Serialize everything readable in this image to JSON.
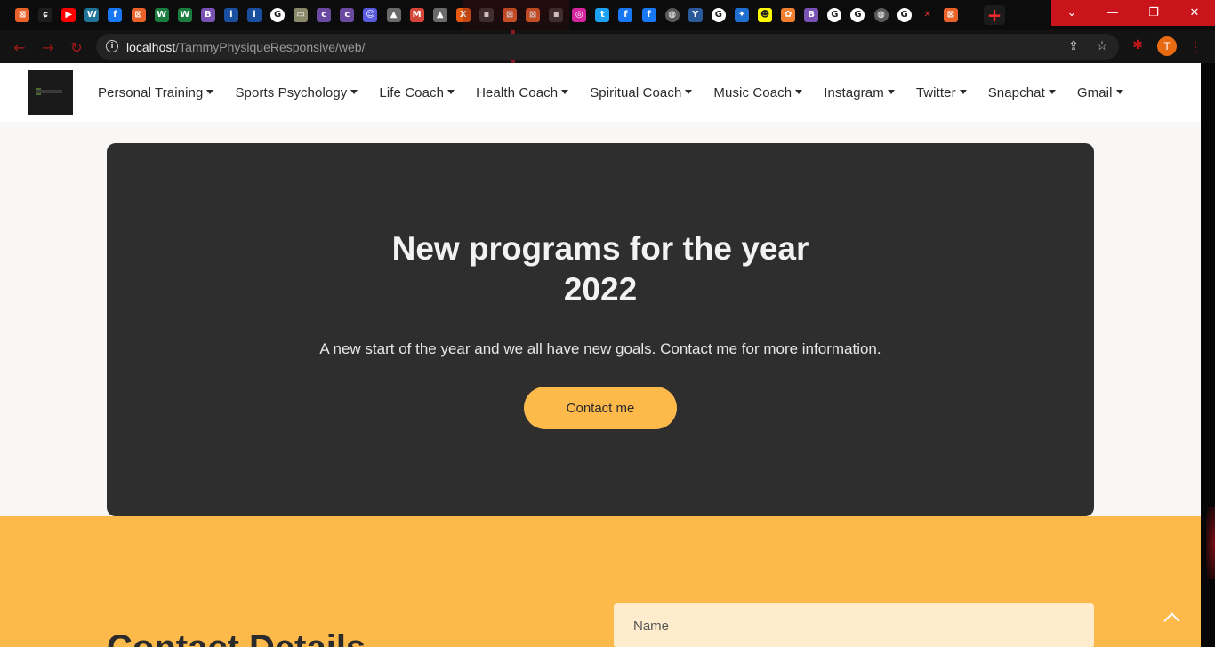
{
  "browser": {
    "tab_favicons": [
      {
        "name": "xampp-favicon",
        "glyph": "⊠",
        "color": "#e8622a"
      },
      {
        "name": "green-favicon",
        "glyph": "ɕ",
        "color": "#1e1e1e"
      },
      {
        "name": "youtube-favicon",
        "glyph": "▶",
        "color": "#ff0000"
      },
      {
        "name": "wordpress-favicon",
        "glyph": "W",
        "color": "#21759b"
      },
      {
        "name": "facebook-favicon",
        "glyph": "f",
        "color": "#1877f2"
      },
      {
        "name": "xampp-favicon",
        "glyph": "⊠",
        "color": "#e8622a"
      },
      {
        "name": "w-favicon",
        "glyph": "W",
        "color": "#1b7d3f"
      },
      {
        "name": "w-favicon",
        "glyph": "W",
        "color": "#1b7d3f"
      },
      {
        "name": "bootstrap-favicon",
        "glyph": "B",
        "color": "#7952b3"
      },
      {
        "name": "info-favicon",
        "glyph": "i",
        "color": "#1a4fa0"
      },
      {
        "name": "info-favicon",
        "glyph": "i",
        "color": "#1a4fa0"
      },
      {
        "name": "google-favicon",
        "glyph": "G",
        "color": "#ffffff"
      },
      {
        "name": "image-favicon",
        "glyph": "▭",
        "color": "#8a8a6a"
      },
      {
        "name": "coloris-favicon",
        "glyph": "c",
        "color": "#6a4aa0"
      },
      {
        "name": "coloris-favicon",
        "glyph": "c",
        "color": "#6a4aa0"
      },
      {
        "name": "chat-favicon",
        "glyph": "☺",
        "color": "#5a5adf"
      },
      {
        "name": "hat-favicon",
        "glyph": "▲",
        "color": "#6a6a6a"
      },
      {
        "name": "gmail-favicon",
        "glyph": "M",
        "color": "#d44638"
      },
      {
        "name": "hat-favicon",
        "glyph": "▲",
        "color": "#6a6a6a"
      },
      {
        "name": "xt-favicon",
        "glyph": "X",
        "color": "#e85a10"
      },
      {
        "name": "dark-favicon",
        "glyph": "▪",
        "color": "#3a3a3a"
      },
      {
        "name": "xampp-favicon",
        "glyph": "⊠",
        "color": "#e8622a"
      },
      {
        "name": "xampp-favicon",
        "glyph": "⊠",
        "color": "#e8622a"
      },
      {
        "name": "dark-favicon",
        "glyph": "▪",
        "color": "#3a3a3a"
      },
      {
        "name": "instagram-favicon",
        "glyph": "◎",
        "color": "#d6249f"
      },
      {
        "name": "twitter-favicon",
        "glyph": "t",
        "color": "#1da1f2"
      },
      {
        "name": "facebook-favicon",
        "glyph": "f",
        "color": "#1877f2"
      },
      {
        "name": "facebook-favicon",
        "glyph": "f",
        "color": "#1877f2"
      },
      {
        "name": "globe-favicon",
        "glyph": "◍",
        "color": "#5a5a5a"
      },
      {
        "name": "y-favicon",
        "glyph": "Y",
        "color": "#2a5a9a"
      },
      {
        "name": "google-favicon",
        "glyph": "G",
        "color": "#ffffff"
      },
      {
        "name": "dots-favicon",
        "glyph": "✦",
        "color": "#1e6fd0"
      },
      {
        "name": "snapchat-favicon",
        "glyph": "☻",
        "color": "#fffc00"
      },
      {
        "name": "app-favicon",
        "glyph": "✿",
        "color": "#f08030"
      },
      {
        "name": "bootstrap-favicon",
        "glyph": "B",
        "color": "#7952b3"
      },
      {
        "name": "google-favicon",
        "glyph": "G",
        "color": "#ffffff"
      },
      {
        "name": "google-favicon",
        "glyph": "G",
        "color": "#ffffff"
      },
      {
        "name": "globe-favicon",
        "glyph": "◍",
        "color": "#5a5a5a"
      },
      {
        "name": "google-favicon",
        "glyph": "G",
        "color": "#ffffff"
      },
      {
        "name": "close-tab-icon",
        "glyph": "✕",
        "color": "#0c0c0c"
      },
      {
        "name": "xampp-favicon",
        "glyph": "⊠",
        "color": "#e8622a"
      }
    ],
    "new_tab_glyph": "+",
    "window_controls": {
      "dropdown": "⌄",
      "minimize": "—",
      "restore": "❐",
      "close": "✕"
    },
    "nav": {
      "back": "←",
      "forward": "→",
      "reload": "↻"
    },
    "url_host": "localhost",
    "url_path": "/TammyPhysiqueResponsive/web/",
    "info_glyph": "i",
    "share_glyph": "⇪",
    "star_glyph": "☆",
    "extension_glyph": "✱",
    "profile_initial": "T",
    "menu_glyph": "⋮"
  },
  "site_nav": {
    "items": [
      {
        "label": "Personal Training"
      },
      {
        "label": "Sports Psychology"
      },
      {
        "label": "Life Coach"
      },
      {
        "label": "Health Coach"
      },
      {
        "label": "Spiritual Coach"
      },
      {
        "label": "Music Coach"
      },
      {
        "label": "Instagram"
      },
      {
        "label": "Twitter"
      },
      {
        "label": "Snapchat"
      },
      {
        "label": "Gmail"
      }
    ]
  },
  "hero": {
    "title_line1": "New programs for the year",
    "title_line2": "2022",
    "text": "A new start of the year and we all have new goals. Contact me for more information.",
    "button_label": "Contact me"
  },
  "contact": {
    "heading": "Contact Details",
    "name_placeholder": "Name"
  },
  "colors": {
    "accent": "#fdb94a",
    "hero_bg": "#2e2e2e",
    "page_bg": "#f8f7f5",
    "input_bg": "#feeccd"
  }
}
